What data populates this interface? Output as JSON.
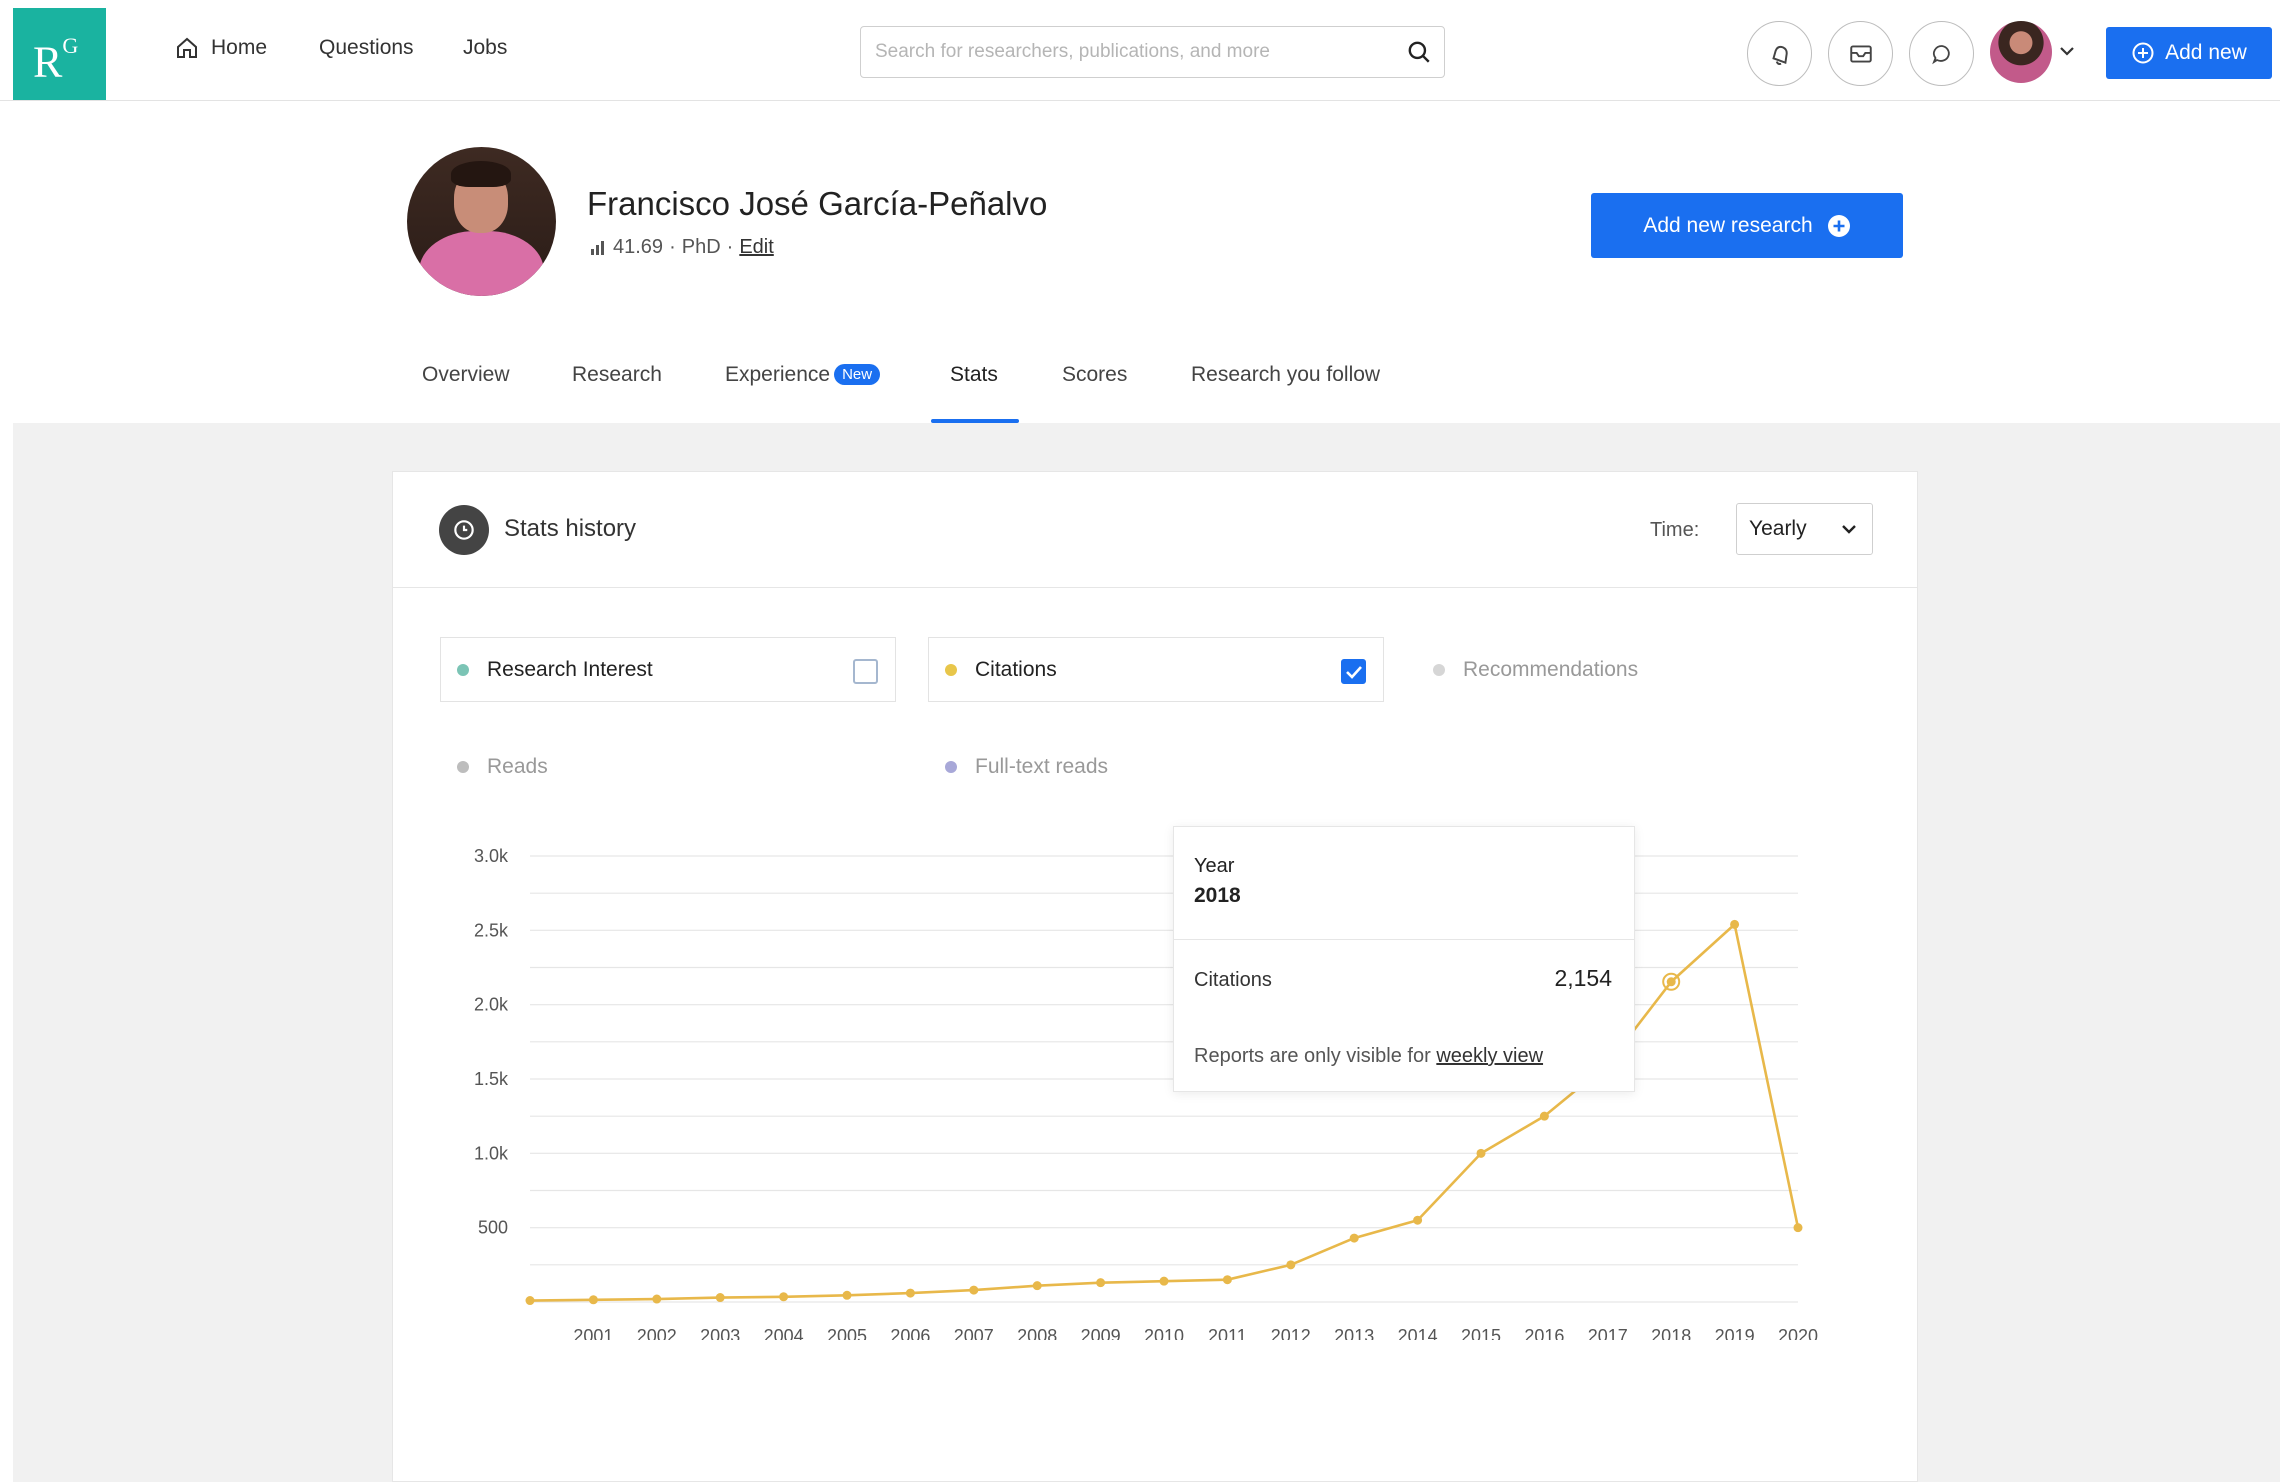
{
  "brand": {
    "logo_text": "R",
    "logo_sup": "G",
    "accent": "#1a6ff0",
    "teal": "#1ab3a0"
  },
  "nav": {
    "home": "Home",
    "questions": "Questions",
    "jobs": "Jobs",
    "search_placeholder": "Search for researchers, publications, and more",
    "add_new": "Add new"
  },
  "profile": {
    "name": "Francisco José García-Peñalvo",
    "score": "41.69",
    "degree": "PhD",
    "edit": "Edit",
    "add_research": "Add new research"
  },
  "tabs": [
    {
      "label": "Overview"
    },
    {
      "label": "Research"
    },
    {
      "label": "Experience",
      "badge": "New"
    },
    {
      "label": "Stats",
      "active": true
    },
    {
      "label": "Scores"
    },
    {
      "label": "Research you follow"
    }
  ],
  "stats": {
    "title": "Stats history",
    "time_label": "Time:",
    "time_value": "Yearly",
    "metrics": [
      {
        "label": "Research Interest",
        "color": "#7bc4b5",
        "checked": false
      },
      {
        "label": "Citations",
        "color": "#e8c64a",
        "checked": true
      },
      {
        "label": "Recommendations",
        "color": "#d6d6d6"
      },
      {
        "label": "Reads",
        "color": "#bdbdbd"
      },
      {
        "label": "Full-text reads",
        "color": "#a8a8d8"
      }
    ]
  },
  "tooltip": {
    "year_label": "Year",
    "year": "2018",
    "metric": "Citations",
    "value": "2,154",
    "note": "Reports are only visible for",
    "note_link": "weekly view"
  },
  "chart_data": {
    "type": "line",
    "x": [
      2000,
      2001,
      2002,
      2003,
      2004,
      2005,
      2006,
      2007,
      2008,
      2009,
      2010,
      2011,
      2012,
      2013,
      2014,
      2015,
      2016,
      2017,
      2018,
      2019,
      2020
    ],
    "x_tick_labels": [
      "2001",
      "2002",
      "2003",
      "2004",
      "2005",
      "2006",
      "2007",
      "2008",
      "2009",
      "2010",
      "2011",
      "2012",
      "2013",
      "2014",
      "2015",
      "2016",
      "2017",
      "2018",
      "2019",
      "2020"
    ],
    "series": [
      {
        "name": "Citations",
        "color": "#e8b84a",
        "values": [
          10,
          15,
          20,
          30,
          35,
          45,
          60,
          80,
          110,
          130,
          140,
          150,
          250,
          430,
          550,
          1000,
          1250,
          1600,
          2154,
          2540,
          500
        ]
      }
    ],
    "y_ticks": [
      500,
      1000,
      1500,
      2000,
      2500,
      3000
    ],
    "y_tick_labels": [
      "500",
      "1.0k",
      "1.5k",
      "2.0k",
      "2.5k",
      "3.0k"
    ],
    "ylim": [
      0,
      3000
    ],
    "highlight_x": 2018,
    "grid": true
  }
}
